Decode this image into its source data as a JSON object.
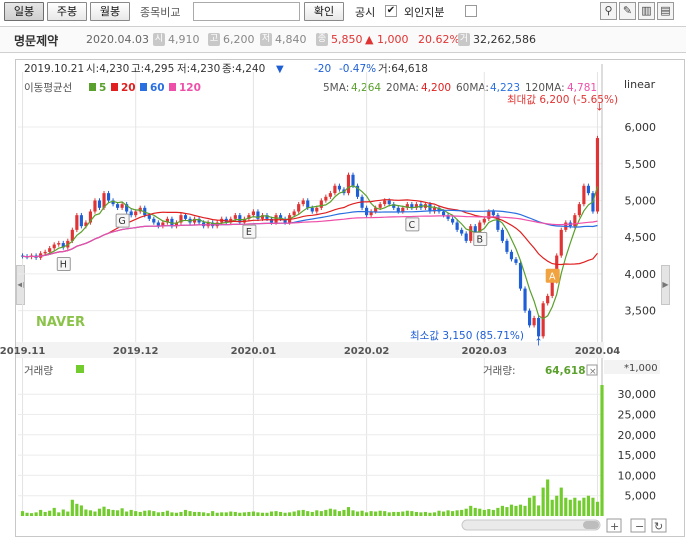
{
  "toolbar": {
    "daily": "일봉",
    "weekly": "주봉",
    "monthly": "월봉",
    "compare_label": "종목비교",
    "compare_value": "",
    "confirm": "확인",
    "disclosure": "공시",
    "disclosure_checked": "✔",
    "foreign": "외인지분",
    "foreign_checked": ""
  },
  "quote": {
    "name": "명문제약",
    "date": "2020.04.03",
    "open_icon": "시",
    "open": "4,910",
    "high_icon": "고",
    "high": "6,200",
    "low_icon": "저",
    "low": "4,840",
    "close_icon": "종",
    "close": "5,850",
    "change": "▲ 1,000",
    "change_pct": "20.62%",
    "vol_icon": "거",
    "volume": "32,262,586"
  },
  "info": {
    "date": "2019.10.21",
    "open": "시:4,230",
    "high": "고:4,295",
    "low": "저:4,230",
    "close": "종:4,240",
    "arrow": "▼",
    "chg": "-20",
    "chg_pct": "-0.47%",
    "vol": "거:64,618"
  },
  "ma_legend": {
    "label": "이동평균선",
    "ma5": "5",
    "ma20": "20",
    "ma60": "60",
    "ma120": "120"
  },
  "ma_values": {
    "ma5_label": "5MA:",
    "ma5": "4,264",
    "ma20_label": "20MA:",
    "ma20": "4,200",
    "ma60_label": "60MA:",
    "ma60": "4,223",
    "ma120_label": "120MA:",
    "ma120": "4,781"
  },
  "scale": "linear",
  "annotations": {
    "max": "최대값 6,200 (-5.65%)",
    "min": "최소값 3,150 (85.71%)",
    "markers": [
      "H",
      "G",
      "E",
      "C",
      "B",
      "A"
    ]
  },
  "watermark": "NAVER",
  "volume_panel": {
    "label": "거래량",
    "value_label": "거래량:",
    "value": "64,618",
    "multiplier": "*1,000"
  },
  "colors": {
    "up": "#e03434",
    "down": "#1f5fd6",
    "ma5": "#5aa02c",
    "ma20": "#e02020",
    "ma60": "#2a6fe0",
    "ma120": "#ee4fa8",
    "volume": "#73cc2e"
  },
  "chart_data": {
    "type": "candlestick",
    "x_ticks": [
      "2019.11",
      "2019.12",
      "2020.01",
      "2020.02",
      "2020.03",
      "2020.04"
    ],
    "y_ticks": [
      3500,
      4000,
      4500,
      5000,
      5500,
      6000
    ],
    "ylim": [
      3100,
      6450
    ],
    "volume_ticks": [
      5000,
      10000,
      15000,
      20000,
      25000,
      30000
    ],
    "volume_ylim": [
      0,
      33500
    ],
    "close": [
      4240,
      4230,
      4250,
      4220,
      4280,
      4300,
      4350,
      4400,
      4420,
      4360,
      4450,
      4600,
      4800,
      4650,
      4700,
      4850,
      5000,
      4900,
      5100,
      5000,
      4950,
      4900,
      4950,
      4850,
      4800,
      4850,
      4900,
      4800,
      4750,
      4700,
      4650,
      4700,
      4750,
      4650,
      4700,
      4800,
      4750,
      4700,
      4750,
      4700,
      4650,
      4700,
      4650,
      4700,
      4750,
      4700,
      4750,
      4800,
      4700,
      4750,
      4800,
      4850,
      4750,
      4800,
      4750,
      4700,
      4800,
      4750,
      4700,
      4800,
      4850,
      4950,
      5000,
      4900,
      4850,
      4900,
      5000,
      5050,
      5100,
      5200,
      5150,
      5100,
      5350,
      5200,
      5050,
      4900,
      4800,
      4850,
      4900,
      4950,
      5000,
      4950,
      4900,
      4850,
      4900,
      4950,
      4900,
      4950,
      4900,
      4950,
      4850,
      4900,
      4850,
      4800,
      4750,
      4700,
      4600,
      4550,
      4450,
      4650,
      4550,
      4700,
      4750,
      4850,
      4800,
      4600,
      4450,
      4300,
      4200,
      4150,
      3800,
      3500,
      3300,
      3400,
      3150,
      3600,
      3700,
      3900,
      4250,
      4600,
      4700,
      4650,
      4800,
      4950,
      5200,
      5100,
      4850,
      5850
    ],
    "volume": [
      1200,
      800,
      700,
      900,
      1500,
      1000,
      1300,
      2000,
      900,
      1600,
      1100,
      4000,
      3000,
      2600,
      1600,
      1400,
      1100,
      1800,
      2300,
      1700,
      1500,
      1400,
      1900,
      1100,
      1500,
      1200,
      1000,
      1300,
      1400,
      1200,
      900,
      1000,
      1300,
      900,
      800,
      1000,
      1500,
      1200,
      1000,
      1000,
      900,
      700,
      1200,
      800,
      900,
      900,
      1100,
      1000,
      800,
      900,
      1000,
      1100,
      900,
      800,
      800,
      1100,
      1200,
      1000,
      800,
      900,
      1100,
      1400,
      1500,
      1200,
      1000,
      1400,
      1200,
      1500,
      1800,
      1600,
      1200,
      1500,
      2200,
      1400,
      1100,
      1300,
      900,
      1200,
      1100,
      1300,
      1200,
      900,
      1000,
      1000,
      1100,
      1300,
      1200,
      1000,
      900,
      1000,
      800,
      900,
      1300,
      1100,
      1400,
      1200,
      1400,
      1500,
      1800,
      2500,
      2000,
      1800,
      1500,
      1700,
      1500,
      2000,
      2500,
      2200,
      2800,
      2500,
      2800,
      2500,
      4500,
      5000,
      2600,
      7000,
      9000,
      4000,
      5000,
      7000,
      4500,
      4000,
      4500,
      3800,
      4500,
      5000,
      4500,
      3500,
      32263
    ],
    "series": [
      {
        "name": "5",
        "type": "ma",
        "period": 5
      },
      {
        "name": "20",
        "type": "ma",
        "period": 20
      },
      {
        "name": "60",
        "type": "ma",
        "period": 60
      },
      {
        "name": "120",
        "type": "ma",
        "period": 120
      }
    ]
  }
}
